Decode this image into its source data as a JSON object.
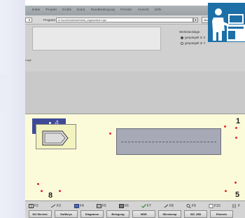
{
  "menu": [
    "Datei",
    "Projekt",
    "Grafik",
    "Extra",
    "Randbedingung",
    "Fenster",
    "Ansicht",
    "Hilfe"
  ],
  "toolbar": {
    "program_label": "Program",
    "program_path": "d:\\\\work\\\\dat\\\\wrk\\\\test_regmarked.mpe",
    "browse_label": "Aus",
    "dropdown_glyph": "▼"
  },
  "panel": {
    "side_label": "Lage",
    "mirror_title": "Werkstücklage",
    "radio_options": [
      {
        "label": "gespiegelt in X",
        "selected": true
      },
      {
        "label": "gespiegelt in Y",
        "selected": false
      }
    ]
  },
  "canvas": {
    "marker_label": "4",
    "corner_labels": {
      "top_right": "1",
      "bottom_left": "8",
      "bottom_right": "5"
    }
  },
  "function_keys": [
    {
      "label": "F2",
      "icon": "grid-icon"
    },
    {
      "label": "F3",
      "icon": "arrow-icon"
    },
    {
      "label": "F4",
      "icon": "table-icon"
    },
    {
      "label": "F5",
      "icon": "layers-icon"
    },
    {
      "label": "F6",
      "icon": "box-icon"
    },
    {
      "label": "F7",
      "icon": "check-icon"
    },
    {
      "label": "F8",
      "icon": "edit-icon"
    },
    {
      "label": "F9",
      "icon": "magnifier-icon"
    },
    {
      "label": "F10",
      "icon": "page-icon"
    },
    {
      "label": "F",
      "icon": "bars-icon"
    }
  ],
  "softkeys": [
    "W2 Wechsl.",
    "Softkeys",
    "Diagramm",
    "Belegung",
    "MDE",
    "Wieskomp",
    "WZ_DBI",
    "Einordn"
  ],
  "colors": {
    "brand": "#1d6fa7",
    "canvas": "#fbfbda",
    "marker": "#3e4a96",
    "dots": "#e32a2a"
  }
}
